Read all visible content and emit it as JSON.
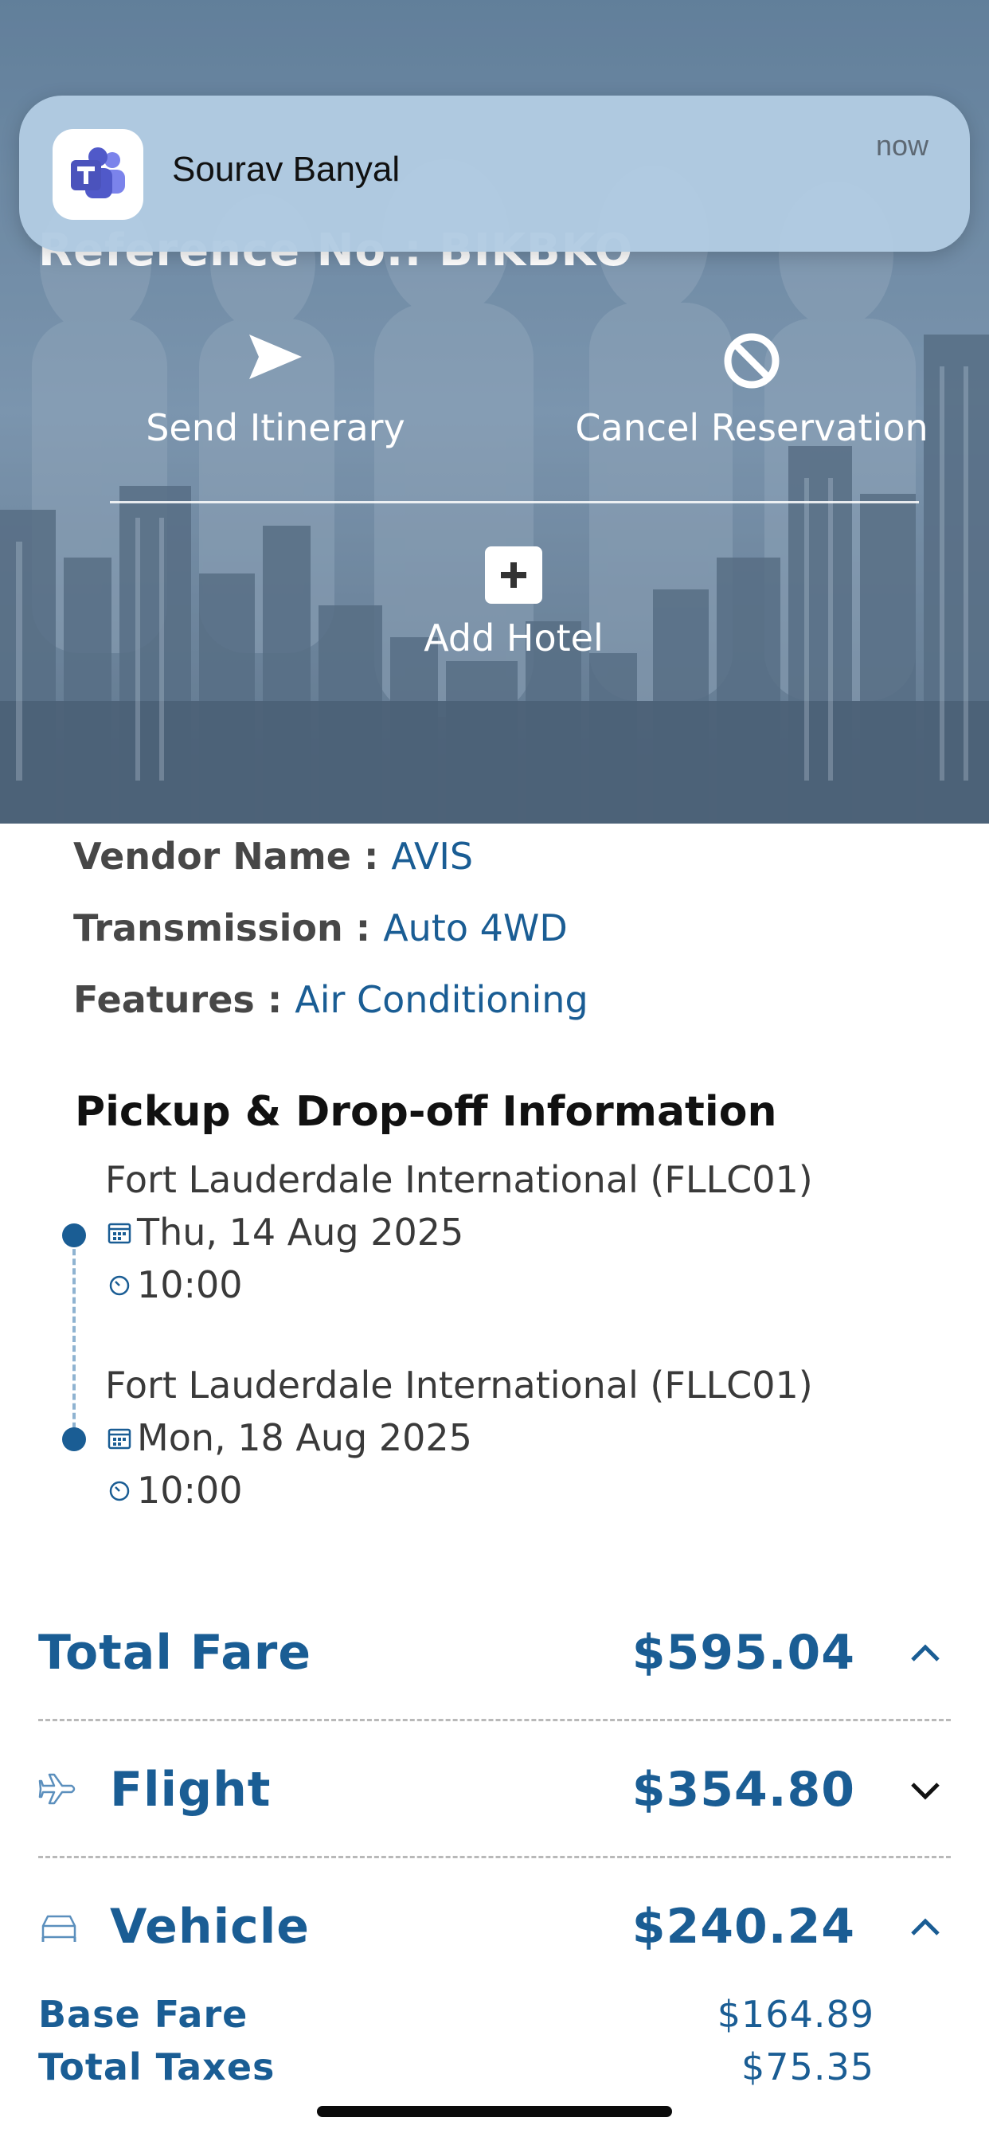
{
  "notification": {
    "app_icon": "microsoft-teams-icon",
    "title": "Sourav Banyal",
    "time": "now"
  },
  "hero": {
    "reference_text": "Reference No.: BIKBKO",
    "actions": [
      {
        "label": "Send Itinerary",
        "icon": "send-icon"
      },
      {
        "label": "Cancel Reservation",
        "icon": "prohibit-icon"
      },
      {
        "label": "Add Hotel",
        "icon": "plus-square-icon"
      }
    ]
  },
  "vehicle_details": [
    {
      "key": "Vendor Name : ",
      "value": "AVIS"
    },
    {
      "key": "Transmission : ",
      "value": "Auto 4WD"
    },
    {
      "key": "Features : ",
      "value": "Air Conditioning"
    }
  ],
  "pickup": {
    "heading": "Pickup & Drop-off Information",
    "stops": [
      {
        "location": "Fort Lauderdale International (FLLC01)",
        "date": "Thu, 14 Aug 2025",
        "time": "10:00"
      },
      {
        "location": "Fort Lauderdale International (FLLC01)",
        "date": "Mon, 18 Aug 2025",
        "time": "10:00"
      }
    ]
  },
  "fare": {
    "total": {
      "label": "Total Fare",
      "amount": "$595.04",
      "state": "expanded"
    },
    "flight": {
      "label": "Flight",
      "amount": "$354.80",
      "icon": "airplane-icon",
      "state": "collapsed"
    },
    "vehicle": {
      "label": "Vehicle",
      "amount": "$240.24",
      "icon": "car-icon",
      "state": "expanded"
    },
    "breakdown": [
      {
        "label": "Base Fare",
        "amount": "$164.89"
      },
      {
        "label": "Total Taxes",
        "amount": "$75.35"
      }
    ]
  },
  "colors": {
    "accent": "#1a5d94",
    "label_gray": "#474747",
    "notification_bg": "#b2cbe2"
  }
}
